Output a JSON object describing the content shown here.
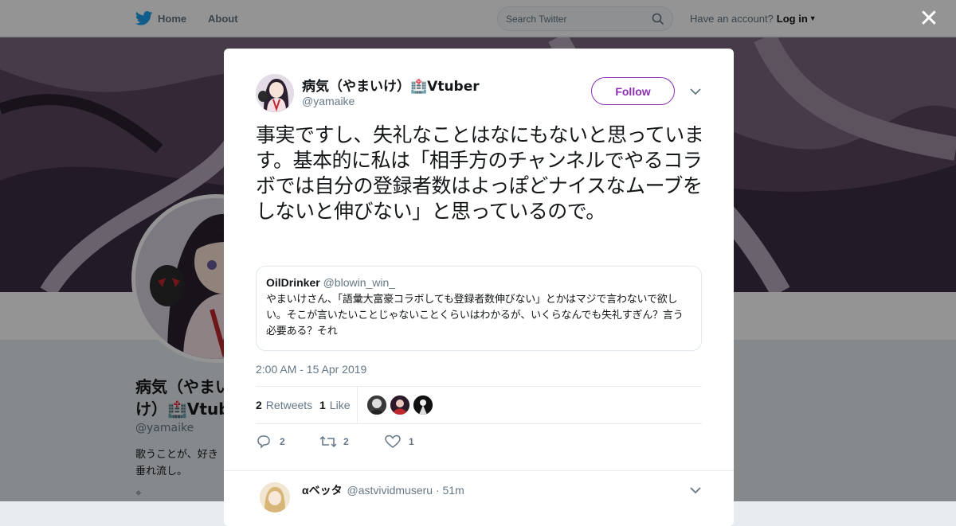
{
  "topbar": {
    "home_label": "Home",
    "about_label": "About",
    "search_placeholder": "Search Twitter",
    "account_prompt": "Have an account?",
    "login_label": "Log in"
  },
  "profile": {
    "display_name_line1": "病気（やまい",
    "display_name_line2": "け）🏥Vtub",
    "handle": "@yamaike",
    "bio_line1": "歌うことが、好き",
    "bio_line2": "垂れ流し。"
  },
  "tweet": {
    "display_name": "病気（やまいけ）🏥Vtuber",
    "handle": "@yamaike",
    "follow_label": "Follow",
    "text": "事実ですし、失礼なことはなにもないと思っています。基本的に私は「相手方のチャンネルでやるコラボでは自分の登録者数はよっぽどナイスなムーブをしないと伸びない」と思っているので。",
    "quote": {
      "name": "OilDrinker",
      "handle": "@blowin_win_",
      "text": "やまいけさん、「語彙大富豪コラボしても登録者数伸びない」とかはマジで言わないで欲しい。そこが言いたいことじゃないことくらいはわかるが、いくらなんでも失礼すぎん？言う必要ある？それ"
    },
    "timestamp": "2:00 AM - 15 Apr 2019",
    "retweets_count": "2",
    "retweets_label": "Retweets",
    "likes_count": "1",
    "likes_label": "Like",
    "actions": {
      "reply_count": "2",
      "retweet_count": "2",
      "like_count": "1"
    }
  },
  "reply": {
    "display_name": "αベッタ",
    "handle": "@astvividmuseru",
    "time": "· 51m"
  },
  "colors": {
    "accent": "#8b2fb0",
    "twitter_blue": "#1da1f2",
    "muted": "#657786"
  }
}
